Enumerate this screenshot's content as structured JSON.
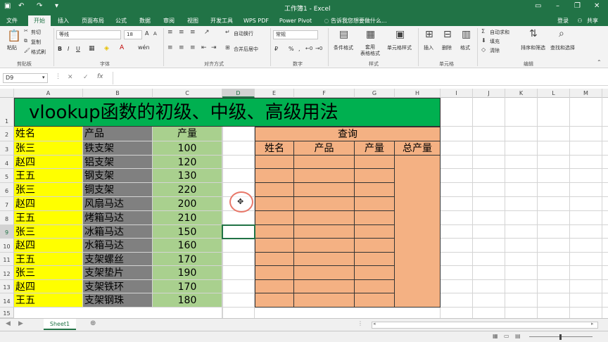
{
  "window": {
    "title": "工作簿1 - Excel",
    "login": "登录",
    "share": "共享"
  },
  "tabs": [
    "文件",
    "开始",
    "插入",
    "页面布局",
    "公式",
    "数据",
    "审阅",
    "视图",
    "开发工具",
    "WPS PDF",
    "Power Pivot"
  ],
  "active_tab": "开始",
  "tell_me": "告诉我您想要做什么...",
  "ribbon": {
    "clipboard": {
      "paste": "粘贴",
      "cut": "剪切",
      "copy": "复制",
      "format_painter": "格式刷",
      "label": "剪贴板"
    },
    "font": {
      "name": "等线",
      "size": "18",
      "label": "字体"
    },
    "alignment": {
      "wrap": "自动换行",
      "merge": "合并后居中",
      "label": "对齐方式"
    },
    "number": {
      "format": "常规",
      "label": "数字"
    },
    "styles": {
      "conditional": "条件格式",
      "as_table": "套用\n表格格式",
      "cell_styles": "单元格样式",
      "label": "样式"
    },
    "cells": {
      "insert": "插入",
      "delete": "删除",
      "format": "格式",
      "label": "单元格"
    },
    "editing": {
      "autosum": "自动求和",
      "fill": "填充",
      "clear": "清除",
      "sort": "排序和筛选",
      "find": "查找和选择",
      "label": "编辑"
    }
  },
  "name_box": "D9",
  "columns": [
    "A",
    "B",
    "C",
    "D",
    "E",
    "F",
    "G",
    "H",
    "I",
    "J",
    "K",
    "L",
    "M"
  ],
  "rows": [
    "1",
    "2",
    "3",
    "4",
    "5",
    "6",
    "7",
    "8",
    "9",
    "10",
    "11",
    "12",
    "13",
    "14",
    "15"
  ],
  "sheet": {
    "title": "vlookup函数的初级、中级、高级用法",
    "headers": {
      "name": "姓名",
      "product": "产品",
      "qty": "产量"
    },
    "data": [
      [
        "张三",
        "铁支架",
        "100"
      ],
      [
        "赵四",
        "铝支架",
        "120"
      ],
      [
        "王五",
        "钢支架",
        "130"
      ],
      [
        "张三",
        "铜支架",
        "220"
      ],
      [
        "赵四",
        "风扇马达",
        "200"
      ],
      [
        "王五",
        "烤箱马达",
        "210"
      ],
      [
        "张三",
        "冰箱马达",
        "150"
      ],
      [
        "赵四",
        "水箱马达",
        "160"
      ],
      [
        "王五",
        "支架螺丝",
        "170"
      ],
      [
        "张三",
        "支架垫片",
        "190"
      ],
      [
        "赵四",
        "支架铁环",
        "170"
      ],
      [
        "王五",
        "支架钢珠",
        "180"
      ]
    ],
    "query": {
      "title": "查询",
      "name": "姓名",
      "product": "产品",
      "qty": "产量",
      "total": "总产量"
    }
  },
  "sheet_tabs": [
    "Sheet1"
  ],
  "colors": {
    "excel_green": "#217346",
    "title_green": "#00b050",
    "yellow": "#ffff00",
    "gray": "#808080",
    "light_green": "#a9d08e",
    "orange": "#f4b183"
  }
}
